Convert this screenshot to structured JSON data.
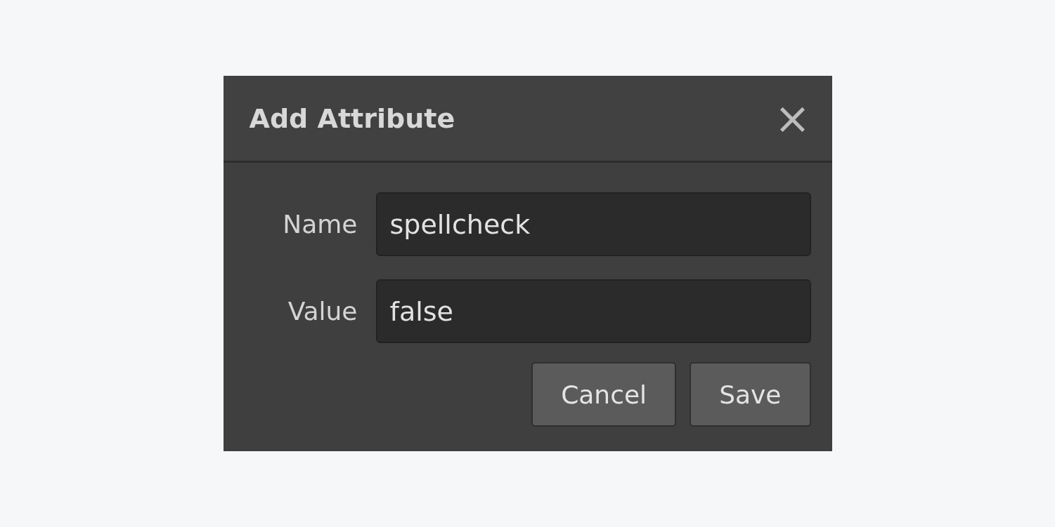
{
  "dialog": {
    "title": "Add Attribute",
    "close": "×",
    "fields": [
      {
        "label": "Name",
        "value": "spellcheck"
      },
      {
        "label": "Value",
        "value": "false"
      }
    ],
    "buttons": [
      "Cancel",
      "Save"
    ]
  }
}
